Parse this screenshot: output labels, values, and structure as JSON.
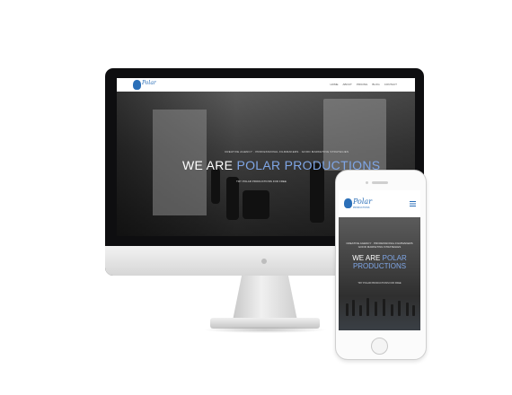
{
  "desktop": {
    "logo_text": "Polar",
    "nav": [
      "HOME",
      "ABOUT",
      "PRICING",
      "BLOG",
      "CONTACT"
    ],
    "subtitle": "CREATIVE AGENCY · PROFESSIONAL FILMMAKERS · GOOD MARKETING STRATEGIES",
    "headline_prefix": "WE ARE",
    "headline_accent": "POLAR PRODUCTIONS",
    "cta": "TRY POLAR PRODUCTIONS FOR FREE"
  },
  "mobile": {
    "logo_text": "Polar",
    "logo_sub": "PRODUCTIONS",
    "menu_icon": "hamburger-icon",
    "line1": "CREATIVE AGENCY · PROFESSIONAL FILMMAKERS",
    "line2": "GOOD MARKETING STRATEGIES",
    "headline_prefix": "WE ARE",
    "headline_accent_1": "POLAR",
    "headline_accent_2": "PRODUCTIONS",
    "cta": "TRY POLAR PRODUCTIONS FOR FREE"
  },
  "colors": {
    "accent": "#7fa6e6",
    "brand": "#2b6fb8"
  }
}
